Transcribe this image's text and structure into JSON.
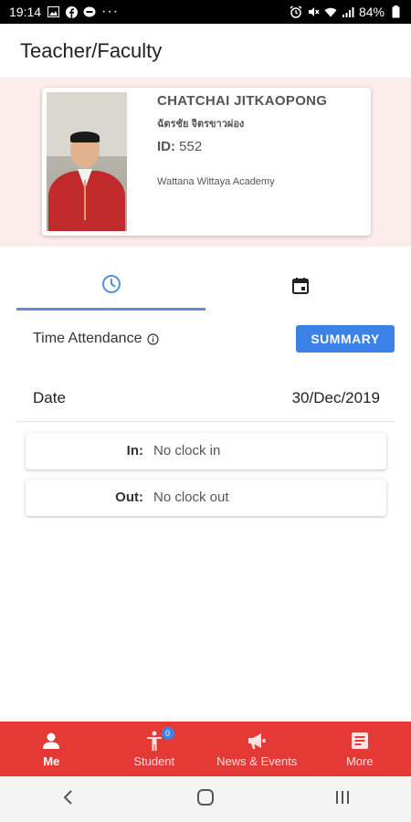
{
  "status_bar": {
    "time": "19:14",
    "more": "···",
    "battery": "84%"
  },
  "app_bar": {
    "title": "Teacher/Faculty"
  },
  "profile": {
    "name": "CHATCHAI JITKAOPONG",
    "thai_name": "ฉัตรชัย จิตรขาวผ่อง",
    "id_label": "ID:",
    "id_value": "552",
    "school": "Wattana Wittaya Academy"
  },
  "tabs": [
    {
      "icon": "clock-icon",
      "active": true
    },
    {
      "icon": "calendar-icon",
      "active": false
    }
  ],
  "attendance": {
    "label": "Time Attendance",
    "summary_button": "SUMMARY",
    "date_label": "Date",
    "date_value": "30/Dec/2019",
    "clock_in_label": "In:",
    "clock_in_value": "No clock in",
    "clock_out_label": "Out:",
    "clock_out_value": "No clock out"
  },
  "bottom_nav": {
    "items": [
      {
        "label": "Me",
        "icon": "person-icon",
        "active": true
      },
      {
        "label": "Student",
        "icon": "accessibility-icon",
        "badge": "0"
      },
      {
        "label": "News & Events",
        "icon": "megaphone-icon"
      },
      {
        "label": "More",
        "icon": "list-box-icon"
      }
    ]
  },
  "colors": {
    "accent_red": "#e53935",
    "primary_blue": "#3b82e8",
    "profile_bg": "#fdecec"
  }
}
